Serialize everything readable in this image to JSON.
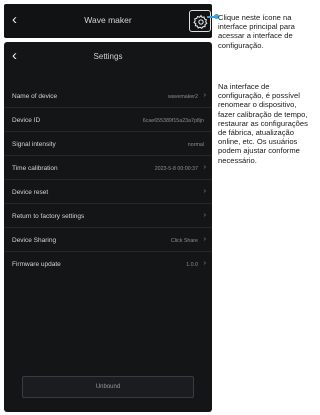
{
  "main_header": {
    "back_icon": "chevron-left-icon",
    "title": "Wave maker",
    "settings_icon": "gear-icon"
  },
  "settings_screen": {
    "back_icon": "chevron-left-icon",
    "title": "Settings",
    "rows": [
      {
        "label": "Name of device",
        "value": "wavemaker2"
      },
      {
        "label": "Device ID",
        "value": "6cae655389f15a23a7p8jn"
      },
      {
        "label": "Signal intensity",
        "value": "normal"
      },
      {
        "label": "Time calibration",
        "value": "2023-5-8 00:00:37"
      },
      {
        "label": "Device reset",
        "value": ""
      },
      {
        "label": "Return to factory settings",
        "value": ""
      },
      {
        "label": "Device Sharing",
        "value": "Click Share"
      },
      {
        "label": "Firmware update",
        "value": "1.0.0"
      }
    ],
    "unbound_label": "Unbound"
  },
  "annotation": {
    "text1": "Clique neste ícone na interface principal para acessar a interface de configuração.",
    "text2": "Na interface de configuração, é possível renomear o dispositivo, fazer calibração de tempo, restaurar as configurações de fábrica, atualização online, etc. Os usuários podem ajustar conforme necessário.",
    "accent_color": "#3aa0e0"
  }
}
